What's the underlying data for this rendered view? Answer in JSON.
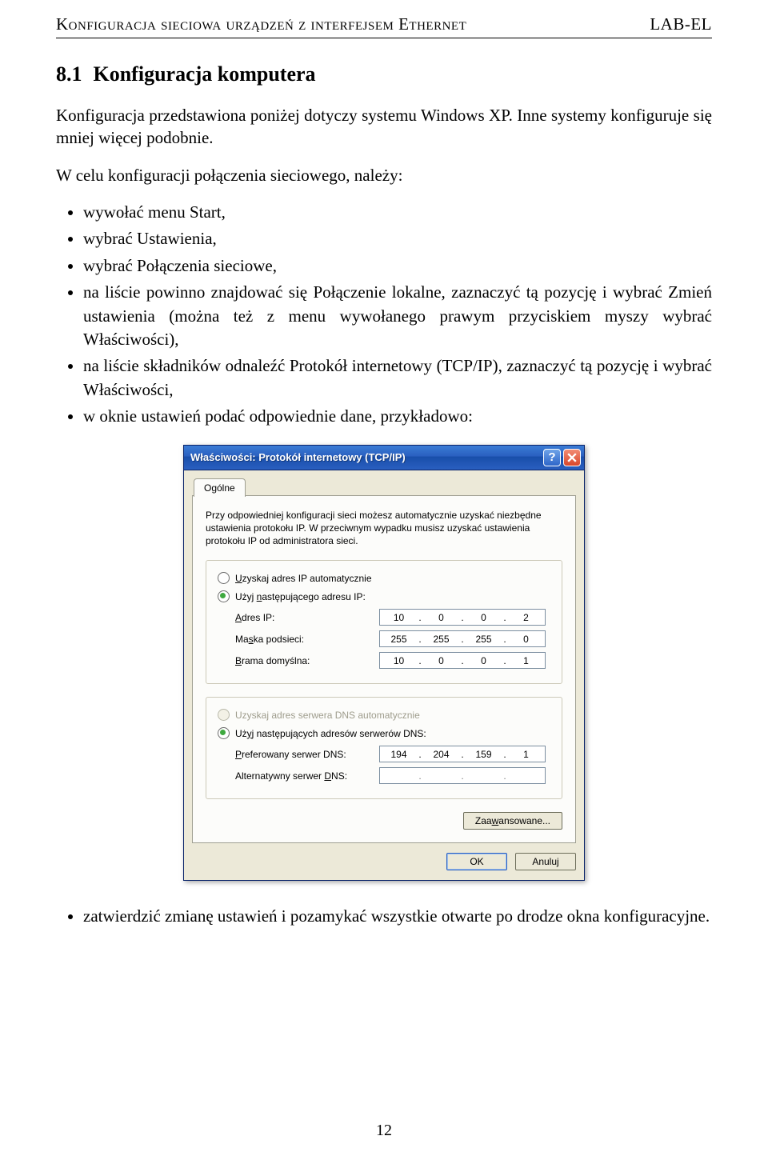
{
  "header": {
    "left": "Konfiguracja sieciowa urządzeń z interfejsem Ethernet",
    "right": "LAB-EL"
  },
  "section": {
    "number": "8.1",
    "title": "Konfiguracja komputera"
  },
  "para1": "Konfiguracja przedstawiona poniżej dotyczy systemu Windows XP. Inne systemy konfiguruje się mniej więcej podobnie.",
  "para2": "W celu konfiguracji połączenia sieciowego, należy:",
  "bullets": [
    "wywołać menu Start,",
    "wybrać Ustawienia,",
    "wybrać Połączenia sieciowe,",
    "na liście powinno znajdować się Połączenie lokalne, zaznaczyć tą pozycję i wybrać Zmień ustawienia (można też z menu wywołanego prawym przyciskiem myszy wybrać Właściwości),",
    "na liście składników odnaleźć Protokół internetowy (TCP/IP), zaznaczyć tą pozycję i wybrać Właściwości,",
    "w oknie ustawień podać odpowiednie dane, przykładowo:"
  ],
  "confirm_bullet": "zatwierdzić zmianę ustawień i pozamykać wszystkie otwarte po drodze okna konfiguracyjne.",
  "page_number": "12",
  "dialog": {
    "title": "Właściwości: Protokół internetowy (TCP/IP)",
    "tab_general": "Ogólne",
    "intro": "Przy odpowiedniej konfiguracji sieci możesz automatycznie uzyskać niezbędne ustawienia protokołu IP. W przeciwnym wypadku musisz uzyskać ustawienia protokołu IP od administratora sieci.",
    "radio_ip_auto": "Uzyskaj adres IP automatycznie",
    "radio_ip_manual_pre": "Użyj ",
    "radio_ip_manual_u": "n",
    "radio_ip_manual_post": "astępującego adresu IP:",
    "label_ip_pre": "",
    "label_ip_u": "A",
    "label_ip_post": "dres IP:",
    "label_mask_pre": "Ma",
    "label_mask_u": "s",
    "label_mask_post": "ka podsieci:",
    "label_gw_pre": "",
    "label_gw_u": "B",
    "label_gw_post": "rama domyślna:",
    "ip": {
      "a": "10",
      "b": "0",
      "c": "0",
      "d": "2"
    },
    "mask": {
      "a": "255",
      "b": "255",
      "c": "255",
      "d": "0"
    },
    "gw": {
      "a": "10",
      "b": "0",
      "c": "0",
      "d": "1"
    },
    "radio_dns_auto": "Uzyskaj adres serwera DNS automatycznie",
    "radio_dns_manual_pre": "Uż",
    "radio_dns_manual_u": "y",
    "radio_dns_manual_post": "j następujących adresów serwerów DNS:",
    "label_pdns_pre": "",
    "label_pdns_u": "P",
    "label_pdns_post": "referowany serwer DNS:",
    "label_adns_pre": "Alternatywny serwer ",
    "label_adns_u": "D",
    "label_adns_post": "NS:",
    "pdns": {
      "a": "194",
      "b": "204",
      "c": "159",
      "d": "1"
    },
    "adns": {
      "a": "",
      "b": "",
      "c": "",
      "d": ""
    },
    "btn_advanced_pre": "Zaa",
    "btn_advanced_u": "w",
    "btn_advanced_post": "ansowane...",
    "btn_ok": "OK",
    "btn_cancel": "Anuluj"
  }
}
